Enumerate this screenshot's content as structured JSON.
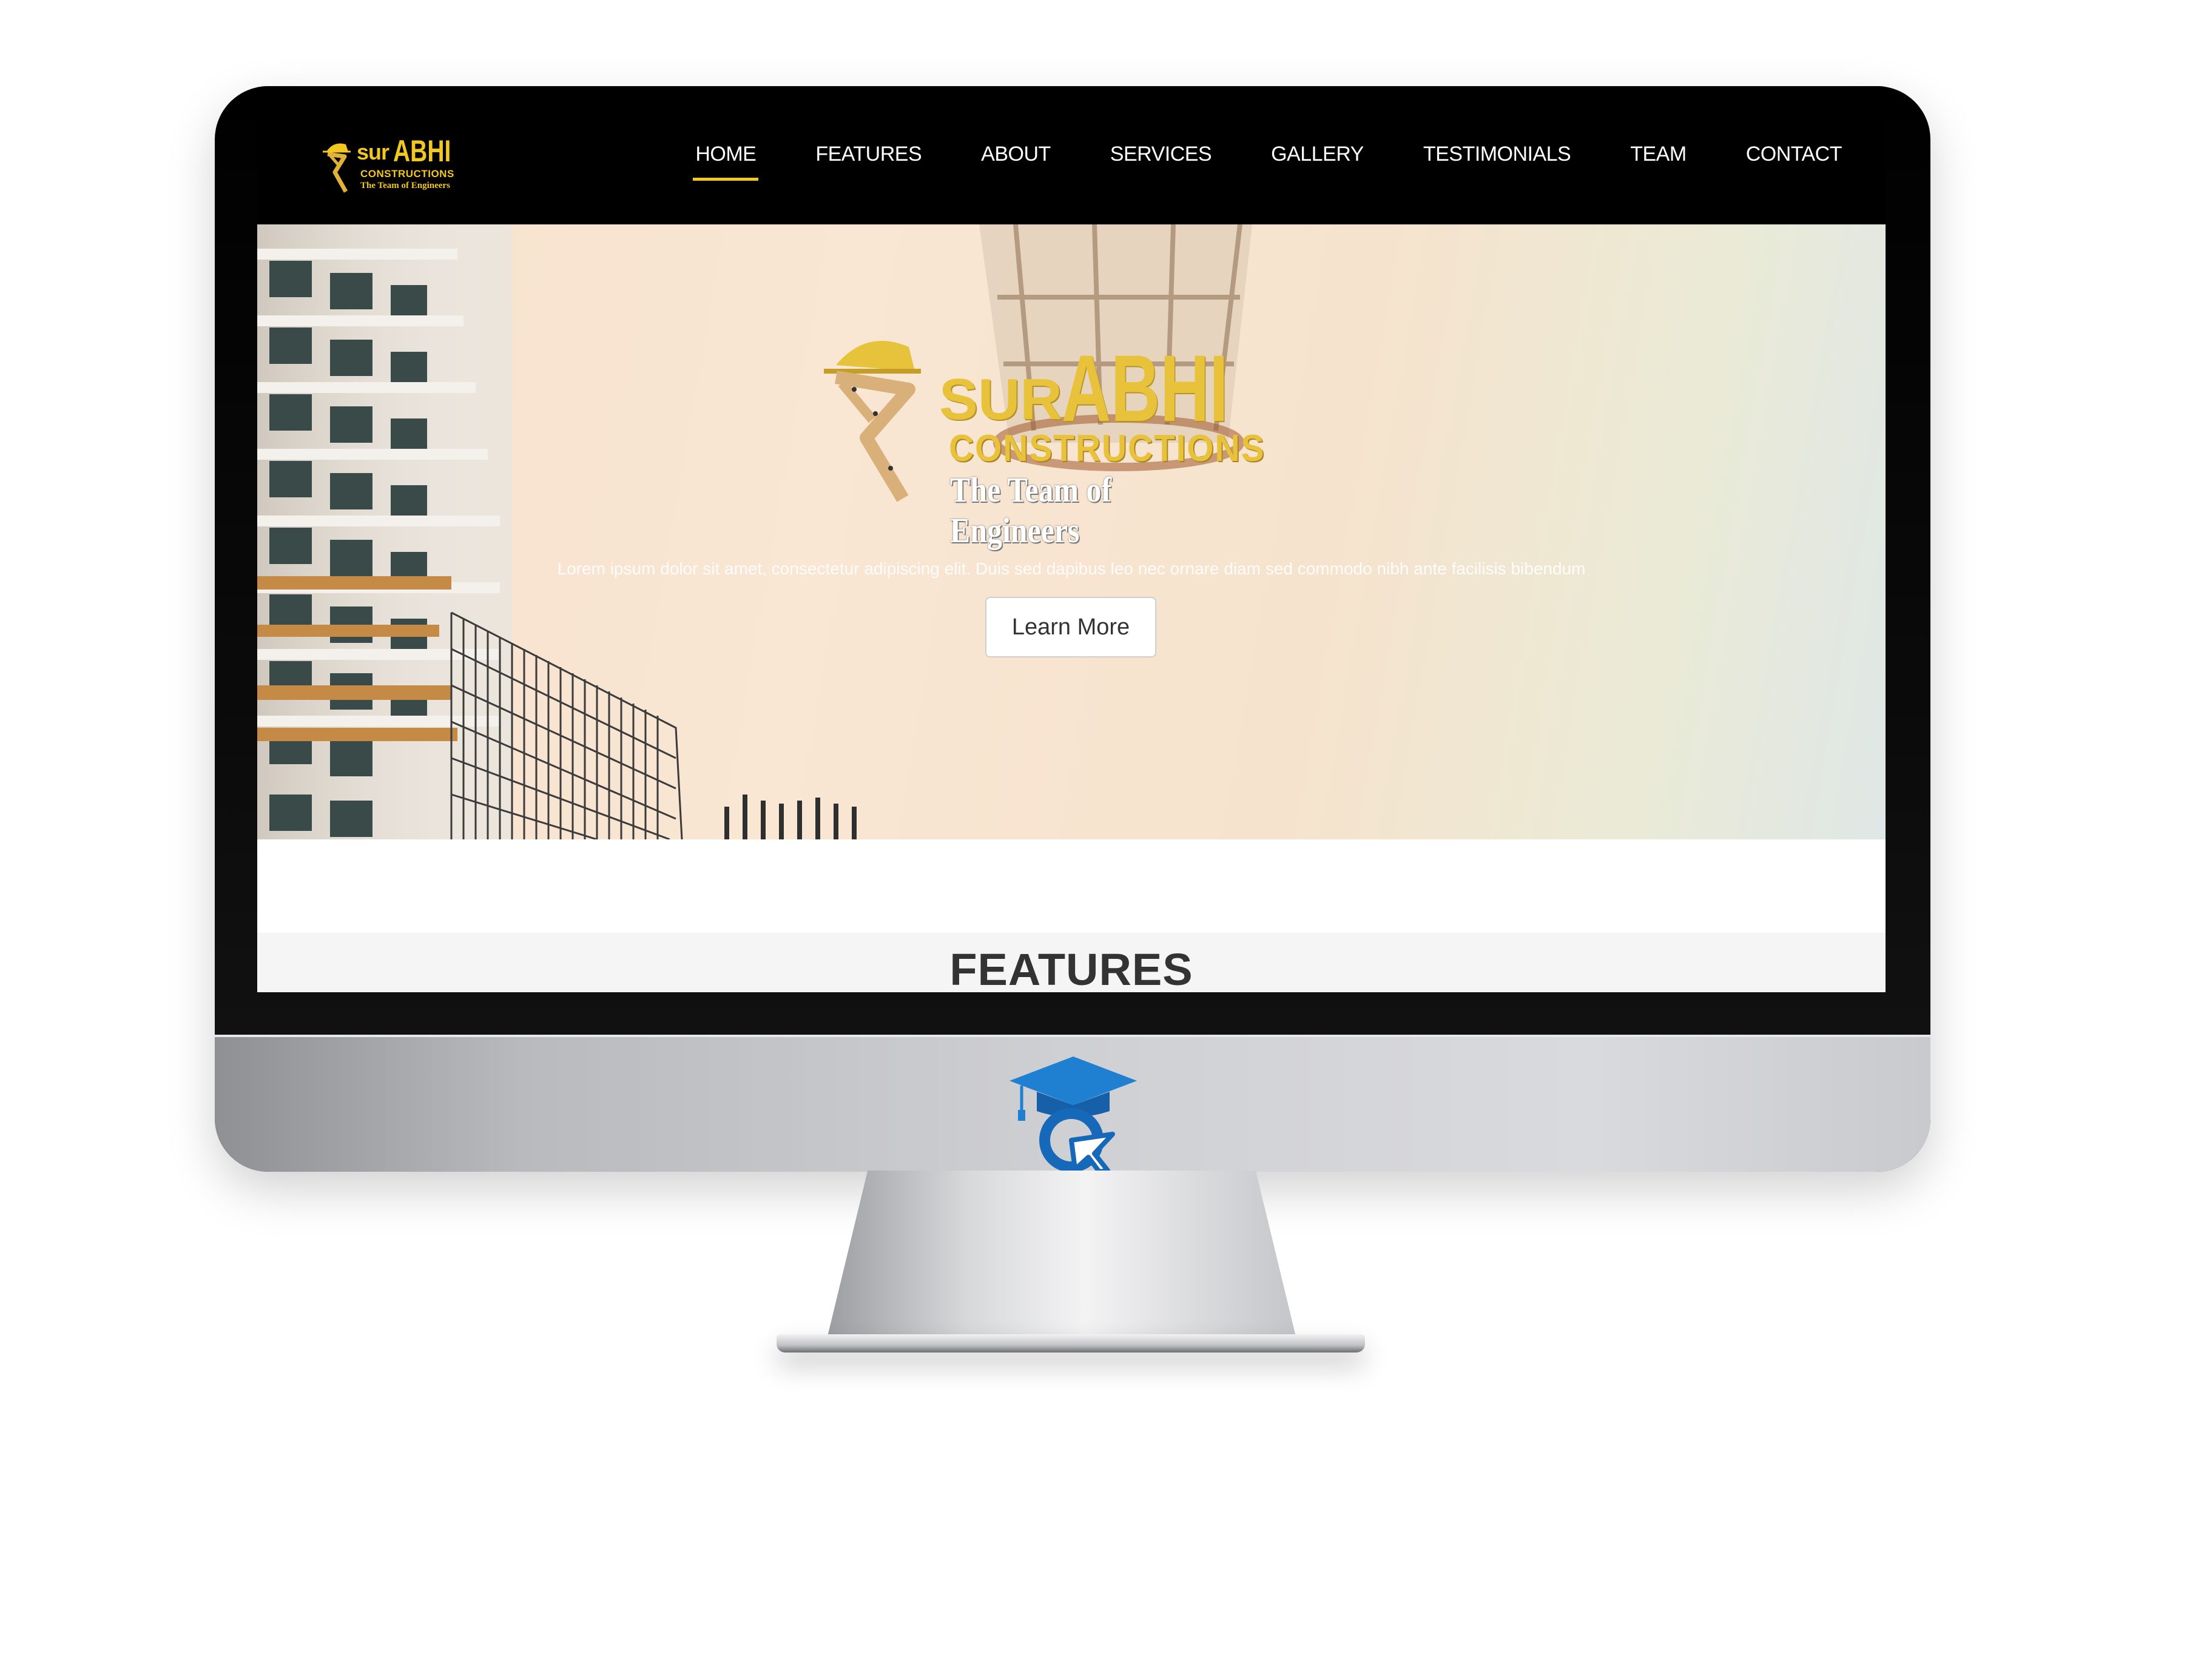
{
  "brand": {
    "line1_small": "sur",
    "line1_big": "ABHI",
    "line2": "CONSTRUCTIONS",
    "line3": "The Team of Engineers"
  },
  "nav": {
    "items": [
      {
        "label": "HOME",
        "active": true
      },
      {
        "label": "FEATURES",
        "active": false
      },
      {
        "label": "ABOUT",
        "active": false
      },
      {
        "label": "SERVICES",
        "active": false
      },
      {
        "label": "GALLERY",
        "active": false
      },
      {
        "label": "TESTIMONIALS",
        "active": false
      },
      {
        "label": "TEAM",
        "active": false
      },
      {
        "label": "CONTACT",
        "active": false
      }
    ]
  },
  "hero": {
    "logo": {
      "sur": "SUR",
      "abhi": "ABHI",
      "constructions": "CONSTRUCTIONS",
      "team": "The Team of Engineers"
    },
    "tagline": "Lorem ipsum dolor sit amet, consectetur adipiscing elit. Duis sed dapibus leo nec ornare diam sed commodo nibh ante facilisis bibendum",
    "cta_label": "Learn More"
  },
  "features": {
    "title": "FEATURES"
  },
  "colors": {
    "accent": "#f2c81e",
    "navbar_bg": "#000000",
    "hero_bg": "#f6e2cc",
    "section_bg": "#f5f5f5",
    "heading_text": "#333333"
  },
  "icons": {
    "brand": "hard-hat-figure-icon",
    "chin": "graduation-cap-cursor-icon"
  }
}
